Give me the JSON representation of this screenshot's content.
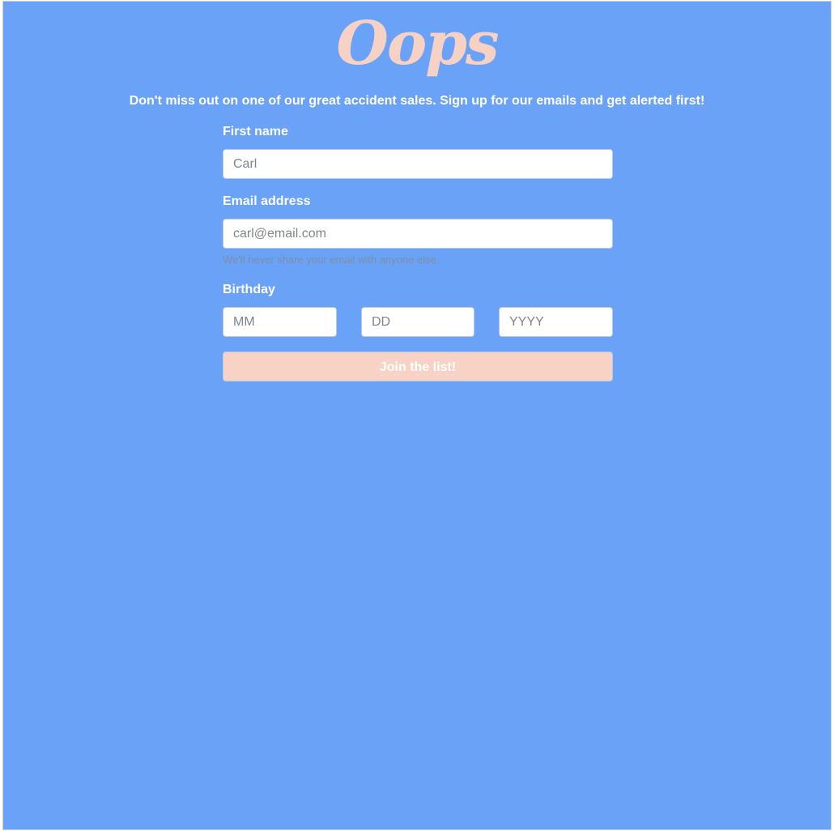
{
  "brand": {
    "logo_text": "Oops",
    "logo_color": "#f8d1c5"
  },
  "colors": {
    "background": "#6aa2f8",
    "button": "#f8d3c5",
    "text": "#ffffff"
  },
  "tagline": "Don't miss out on one of our great accident sales. Sign up for our emails and get alerted first!",
  "form": {
    "first_name": {
      "label": "First name",
      "placeholder": "Carl",
      "value": ""
    },
    "email": {
      "label": "Email address",
      "placeholder": "carl@email.com",
      "value": "",
      "help": "We'll never share your email with anyone else."
    },
    "birthday": {
      "label": "Birthday",
      "month_placeholder": "MM",
      "day_placeholder": "DD",
      "year_placeholder": "YYYY"
    },
    "submit_label": "Join the list!"
  }
}
